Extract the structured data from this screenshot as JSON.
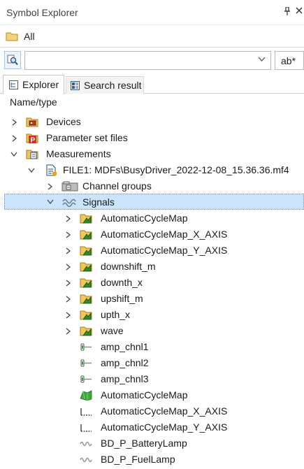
{
  "panel": {
    "title": "Symbol Explorer",
    "pin_glyph": "📌",
    "close_glyph": "✕"
  },
  "filter": {
    "label": "All"
  },
  "search": {
    "value": "",
    "placeholder": "",
    "mode": "ab*"
  },
  "tabs": [
    {
      "label": "Explorer",
      "icon": "explorer-tab-icon",
      "active": true
    },
    {
      "label": "Search result",
      "icon": "search-result-tab-icon",
      "active": false
    }
  ],
  "tree": {
    "column_header": "Name/type",
    "items": [
      {
        "label": "Devices",
        "icon": "devices-folder-icon",
        "expander": "collapsed"
      },
      {
        "label": "Parameter set files",
        "icon": "parameter-file-icon",
        "expander": "collapsed"
      },
      {
        "label": "Measurements",
        "icon": "measurements-folder-icon",
        "expander": "expanded"
      },
      {
        "label": "FILE1: MDFs\\BusyDriver_2022-12-08_15.36.36.mf4",
        "icon": "mdf-file-icon",
        "expander": "expanded"
      },
      {
        "label": "Channel groups",
        "icon": "channel-groups-icon",
        "expander": "collapsed"
      },
      {
        "label": "Signals",
        "icon": "signals-wave-icon",
        "expander": "expanded",
        "selected": true
      },
      {
        "label": "AutomaticCycleMap",
        "icon": "signal-folder-icon",
        "expander": "collapsed"
      },
      {
        "label": "AutomaticCycleMap_X_AXIS",
        "icon": "signal-folder-icon",
        "expander": "collapsed"
      },
      {
        "label": "AutomaticCycleMap_Y_AXIS",
        "icon": "signal-folder-icon",
        "expander": "collapsed"
      },
      {
        "label": "downshift_m",
        "icon": "signal-folder-icon",
        "expander": "collapsed"
      },
      {
        "label": "downth_x",
        "icon": "signal-folder-icon",
        "expander": "collapsed"
      },
      {
        "label": "upshift_m",
        "icon": "signal-folder-icon",
        "expander": "collapsed"
      },
      {
        "label": "upth_x",
        "icon": "signal-folder-icon",
        "expander": "collapsed"
      },
      {
        "label": "wave",
        "icon": "signal-folder-icon",
        "expander": "collapsed"
      },
      {
        "label": "amp_chnl1",
        "icon": "channel-signal-icon",
        "expander": "none"
      },
      {
        "label": "amp_chnl2",
        "icon": "channel-signal-icon",
        "expander": "none"
      },
      {
        "label": "amp_chnl3",
        "icon": "channel-signal-icon",
        "expander": "none"
      },
      {
        "label": "AutomaticCycleMap",
        "icon": "map-signal-icon",
        "expander": "none"
      },
      {
        "label": "AutomaticCycleMap_X_AXIS",
        "icon": "axis-signal-icon",
        "expander": "none"
      },
      {
        "label": "AutomaticCycleMap_Y_AXIS",
        "icon": "axis-signal-icon",
        "expander": "none"
      },
      {
        "label": "BD_P_BatteryLamp",
        "icon": "wave-signal-icon",
        "expander": "none"
      },
      {
        "label": "BD_P_FuelLamp",
        "icon": "wave-signal-icon",
        "expander": "none"
      }
    ]
  },
  "colors": {
    "selection": "#cce4fb",
    "folder": "#e8c45a",
    "signal_green": "#2e8b2e"
  }
}
